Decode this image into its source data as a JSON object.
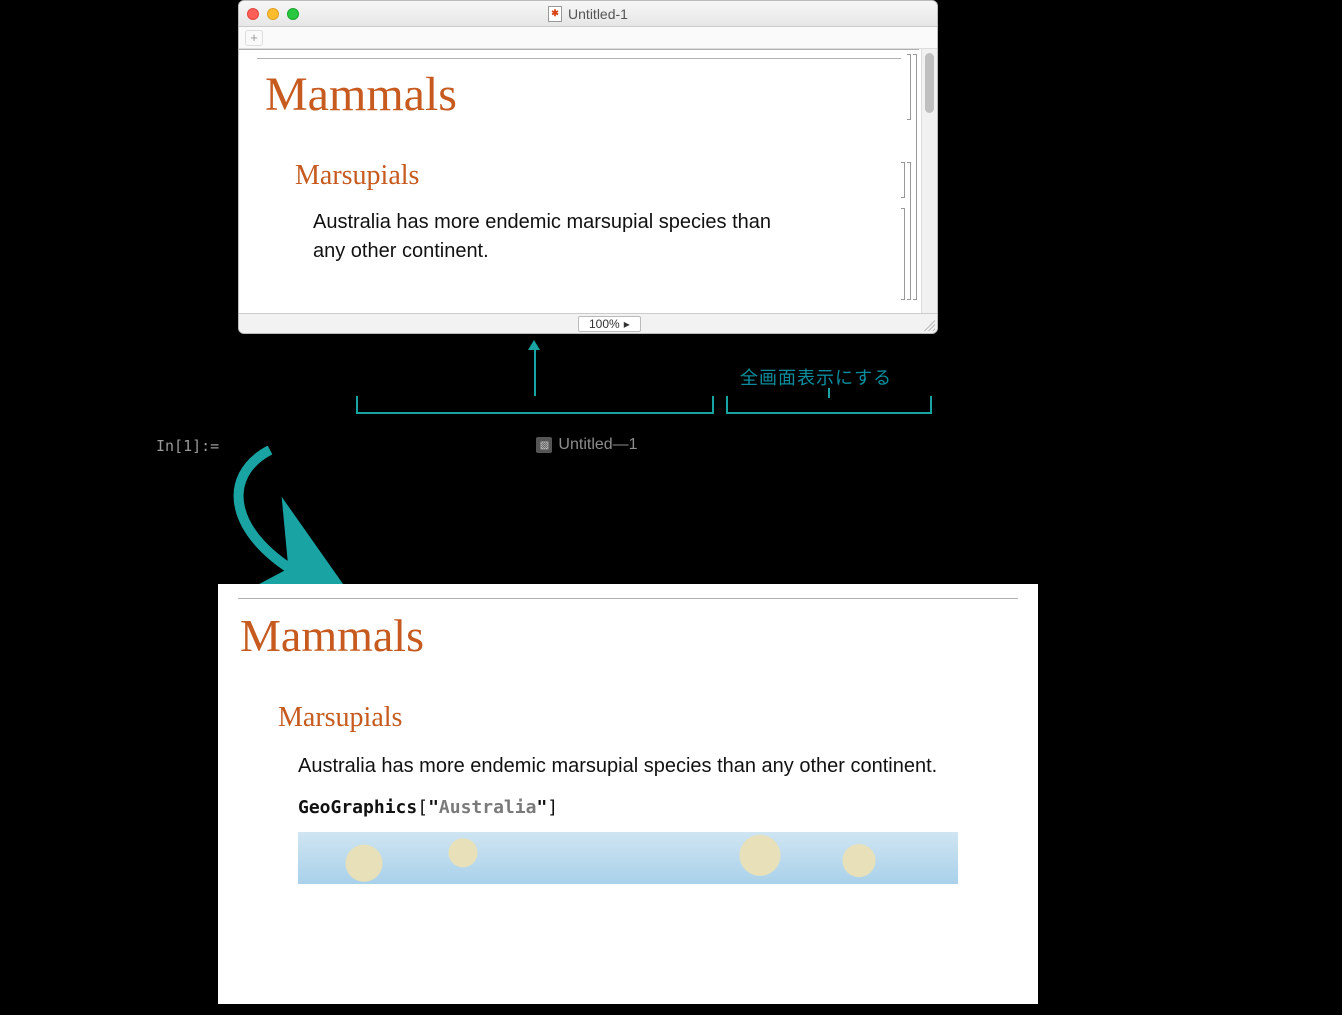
{
  "window": {
    "title": "Untitled-1",
    "zoom": "100%",
    "plus": "+"
  },
  "doc": {
    "title": "Mammals",
    "section": "Marsupials",
    "text_a": "Australia has more endemic marsupial species than",
    "text_b": "any other continent.",
    "text_full": "Australia has more endemic marsupial species than any other continent."
  },
  "anno": {
    "fullscreen_label": "全画面表示にする",
    "in_label": "In[1]:="
  },
  "fs": {
    "title": "Untitled—1"
  },
  "code": {
    "fn": "GeoGraphics",
    "lbr": "[",
    "q1": "\"",
    "arg": "Australia",
    "q2": "\"",
    "rbr": "]"
  }
}
